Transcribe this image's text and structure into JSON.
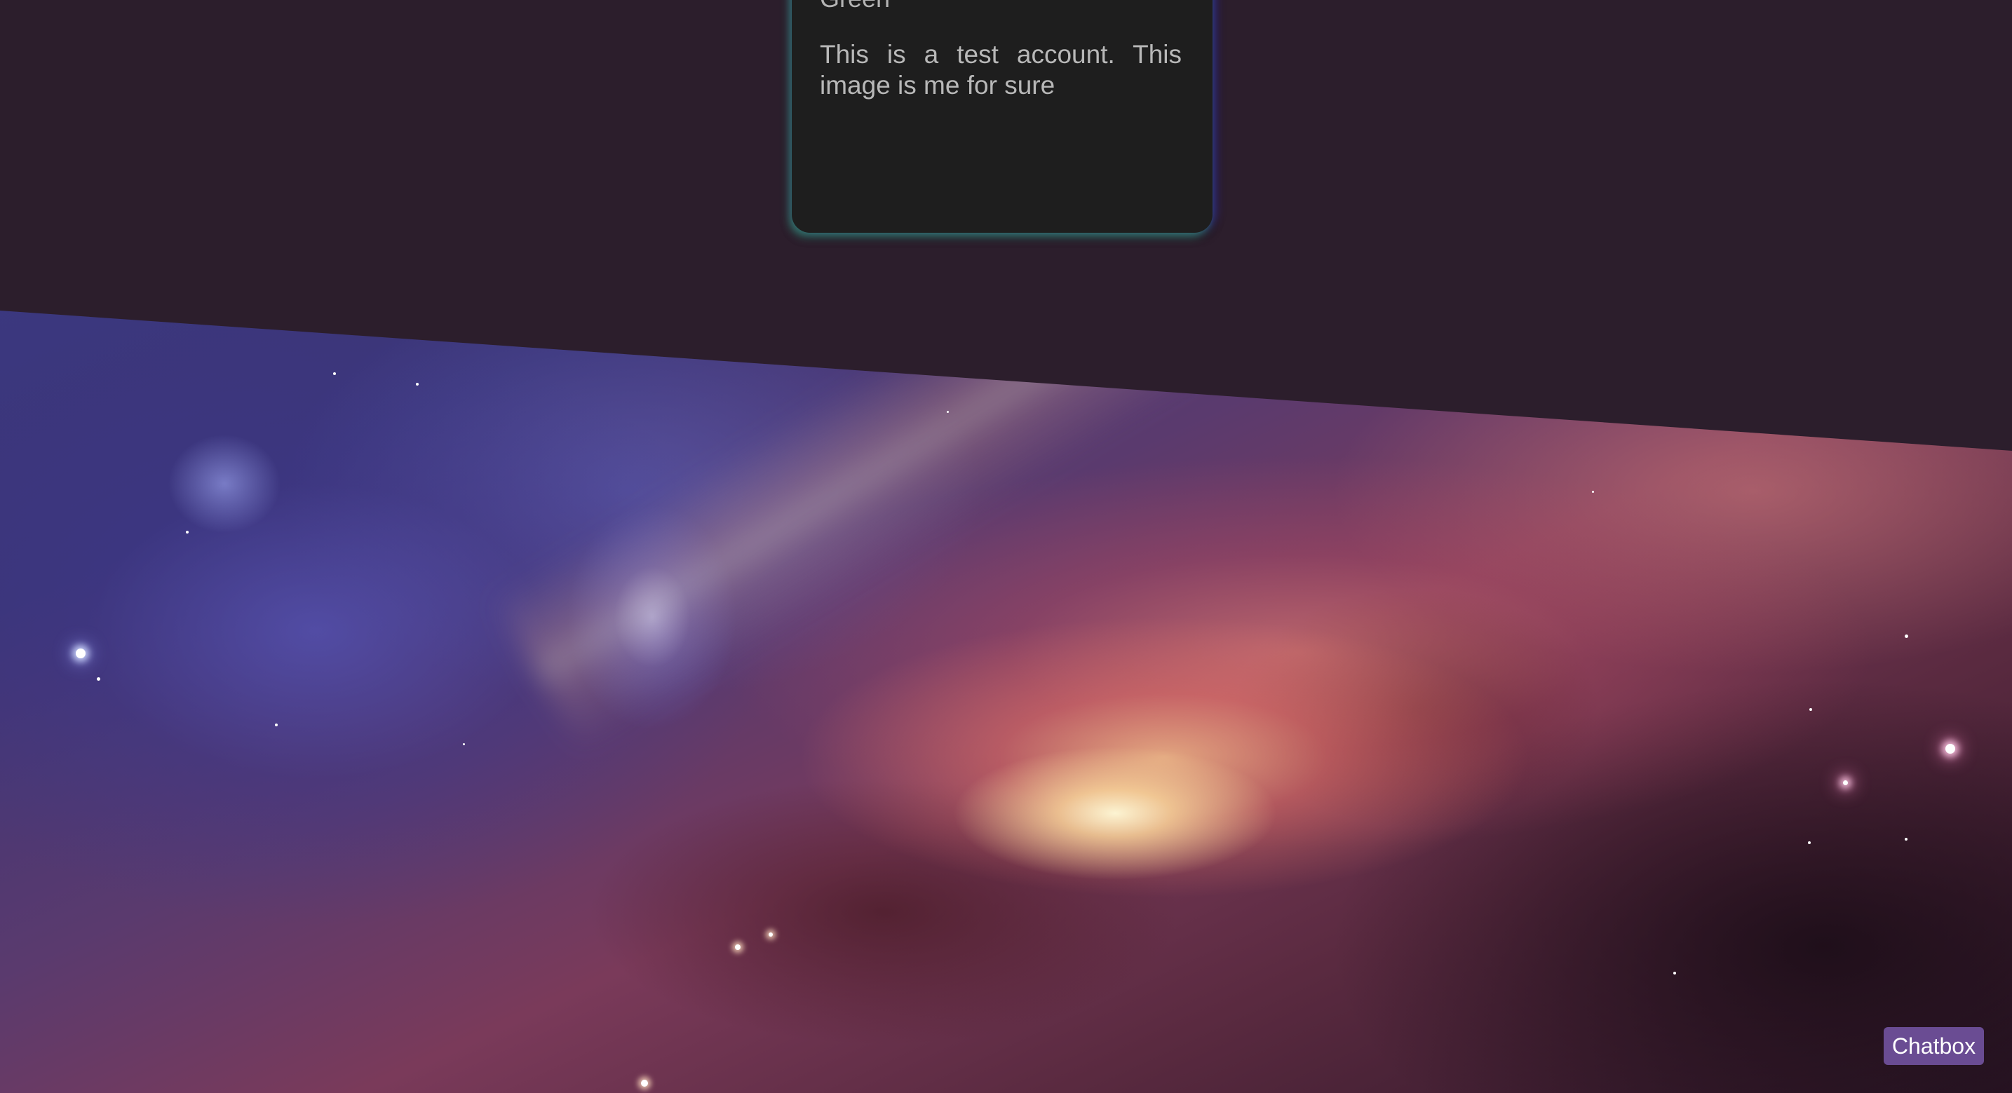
{
  "profile": {
    "name": "Green",
    "bio": "This is a test account. This image is me for sure"
  },
  "chat": {
    "button_label": "Chatbox"
  },
  "colors": {
    "page_background": "#2c1e2c",
    "card_background": "#1e1e1e",
    "card_text": "#b8b8b8",
    "chat_button": "#6a4c93"
  }
}
